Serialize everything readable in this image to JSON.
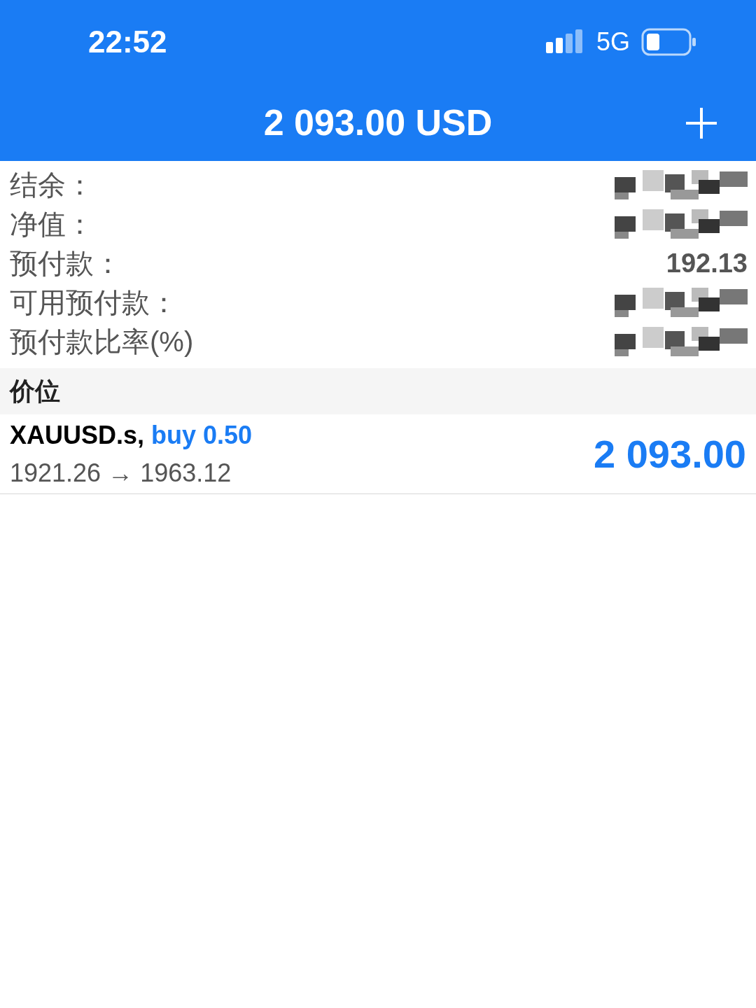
{
  "status_bar": {
    "time": "22:52",
    "network": "5G"
  },
  "header": {
    "title": "2 093.00 USD"
  },
  "summary": [
    {
      "label": "结余：",
      "redacted": true
    },
    {
      "label": "净值：",
      "redacted": true
    },
    {
      "label": "预付款：",
      "redacted": false,
      "value": "192.13"
    },
    {
      "label": "可用预付款：",
      "redacted": true
    },
    {
      "label": "预付款比率(%)",
      "redacted": true
    }
  ],
  "section": {
    "title": "价位"
  },
  "positions": [
    {
      "symbol": "XAUUSD.s,",
      "side": "buy 0.50",
      "prices": "1921.26 → 1963.12",
      "profit": "2 093.00"
    }
  ]
}
